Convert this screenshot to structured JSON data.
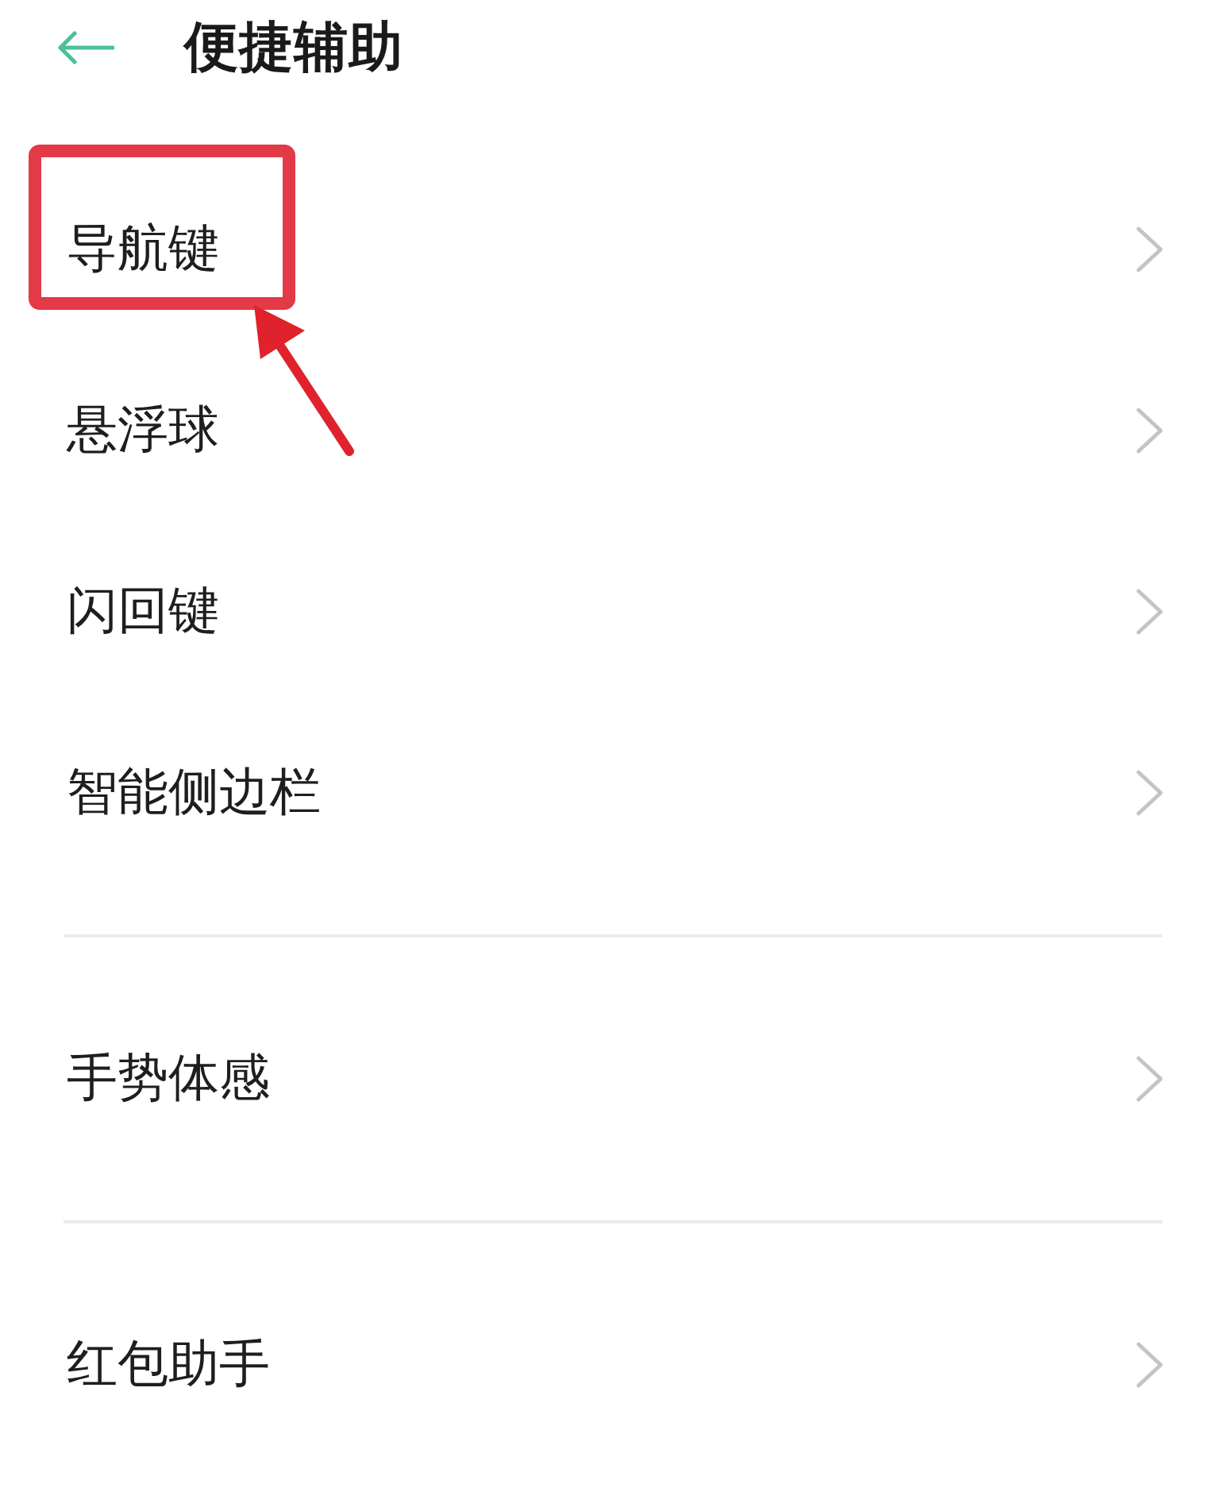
{
  "header": {
    "title": "便捷辅助"
  },
  "groups": [
    {
      "items": [
        {
          "label": "导航键",
          "highlighted": true
        },
        {
          "label": "悬浮球",
          "highlighted": false
        },
        {
          "label": "闪回键",
          "highlighted": false
        },
        {
          "label": "智能侧边栏",
          "highlighted": false
        }
      ]
    },
    {
      "items": [
        {
          "label": "手势体感",
          "highlighted": false
        }
      ]
    },
    {
      "items": [
        {
          "label": "红包助手",
          "highlighted": false
        }
      ]
    }
  ]
}
